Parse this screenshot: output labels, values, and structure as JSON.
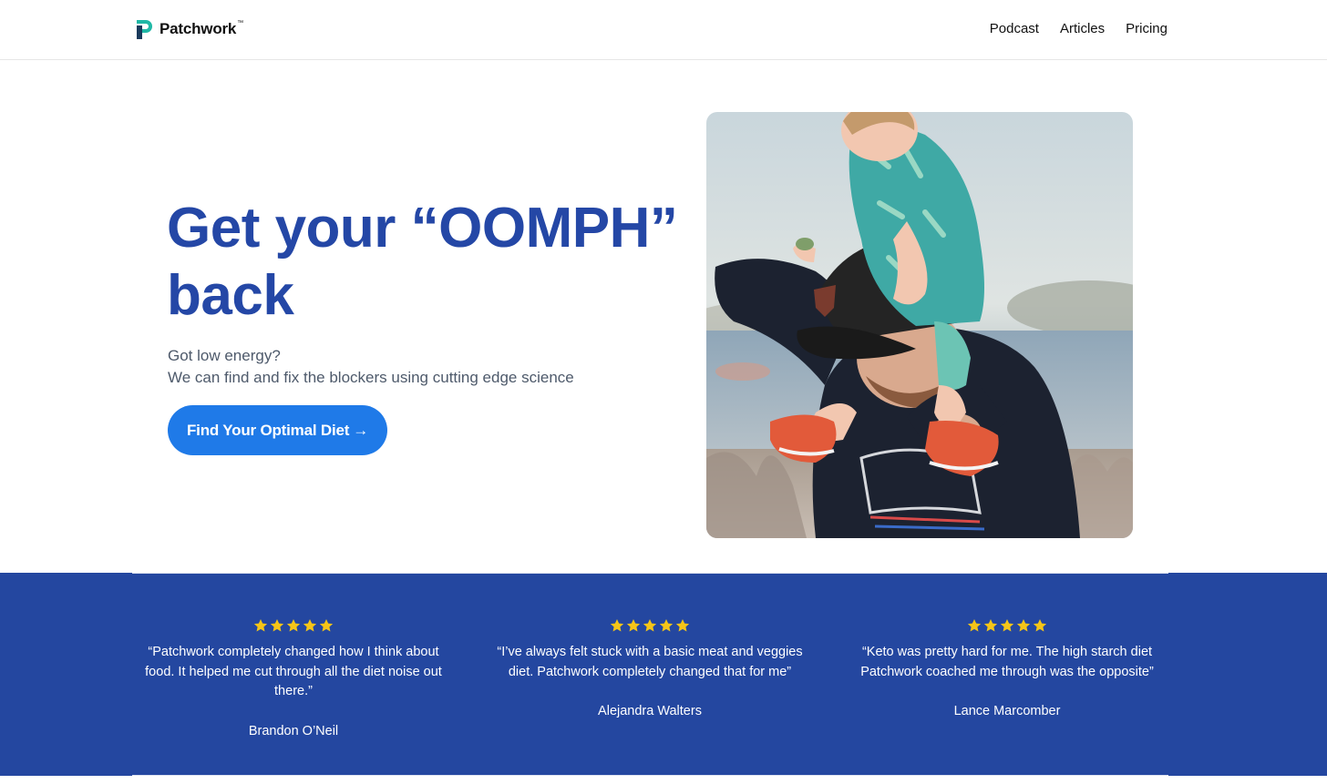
{
  "brand": {
    "name": "Patchwork",
    "trademark": "™",
    "logo_icon": "patchwork-p-logo-icon",
    "colors": {
      "primary": "#2447a6",
      "accent": "#1f7ae8",
      "logo_teal": "#1fb8a6",
      "logo_dark": "#1a3a5c"
    }
  },
  "nav": {
    "items": [
      {
        "label": "Podcast"
      },
      {
        "label": "Articles"
      },
      {
        "label": "Pricing"
      }
    ]
  },
  "hero": {
    "title": "Get your “OOMPH” back",
    "subtitle_line1": "Got low energy?",
    "subtitle_line2": "We can find and fix the blockers using cutting edge science",
    "cta_label": "Find Your Optimal Diet",
    "cta_arrow": "→"
  },
  "testimonials": {
    "band_color": "#2447a0",
    "star_color": "#f5c518",
    "items": [
      {
        "rating": 5,
        "quote": "“Patchwork completely changed how I think about food. It helped me cut through all the diet noise out there.”",
        "author": "Brandon O’Neil"
      },
      {
        "rating": 5,
        "quote": "“I’ve always felt stuck with a basic meat and veggies diet. Patchwork completely changed that for me”",
        "author": "Alejandra Walters"
      },
      {
        "rating": 5,
        "quote": "“Keto was pretty hard for me. The high starch diet Patchwork coached me through was the opposite”",
        "author": "Lance Marcomber"
      }
    ]
  }
}
